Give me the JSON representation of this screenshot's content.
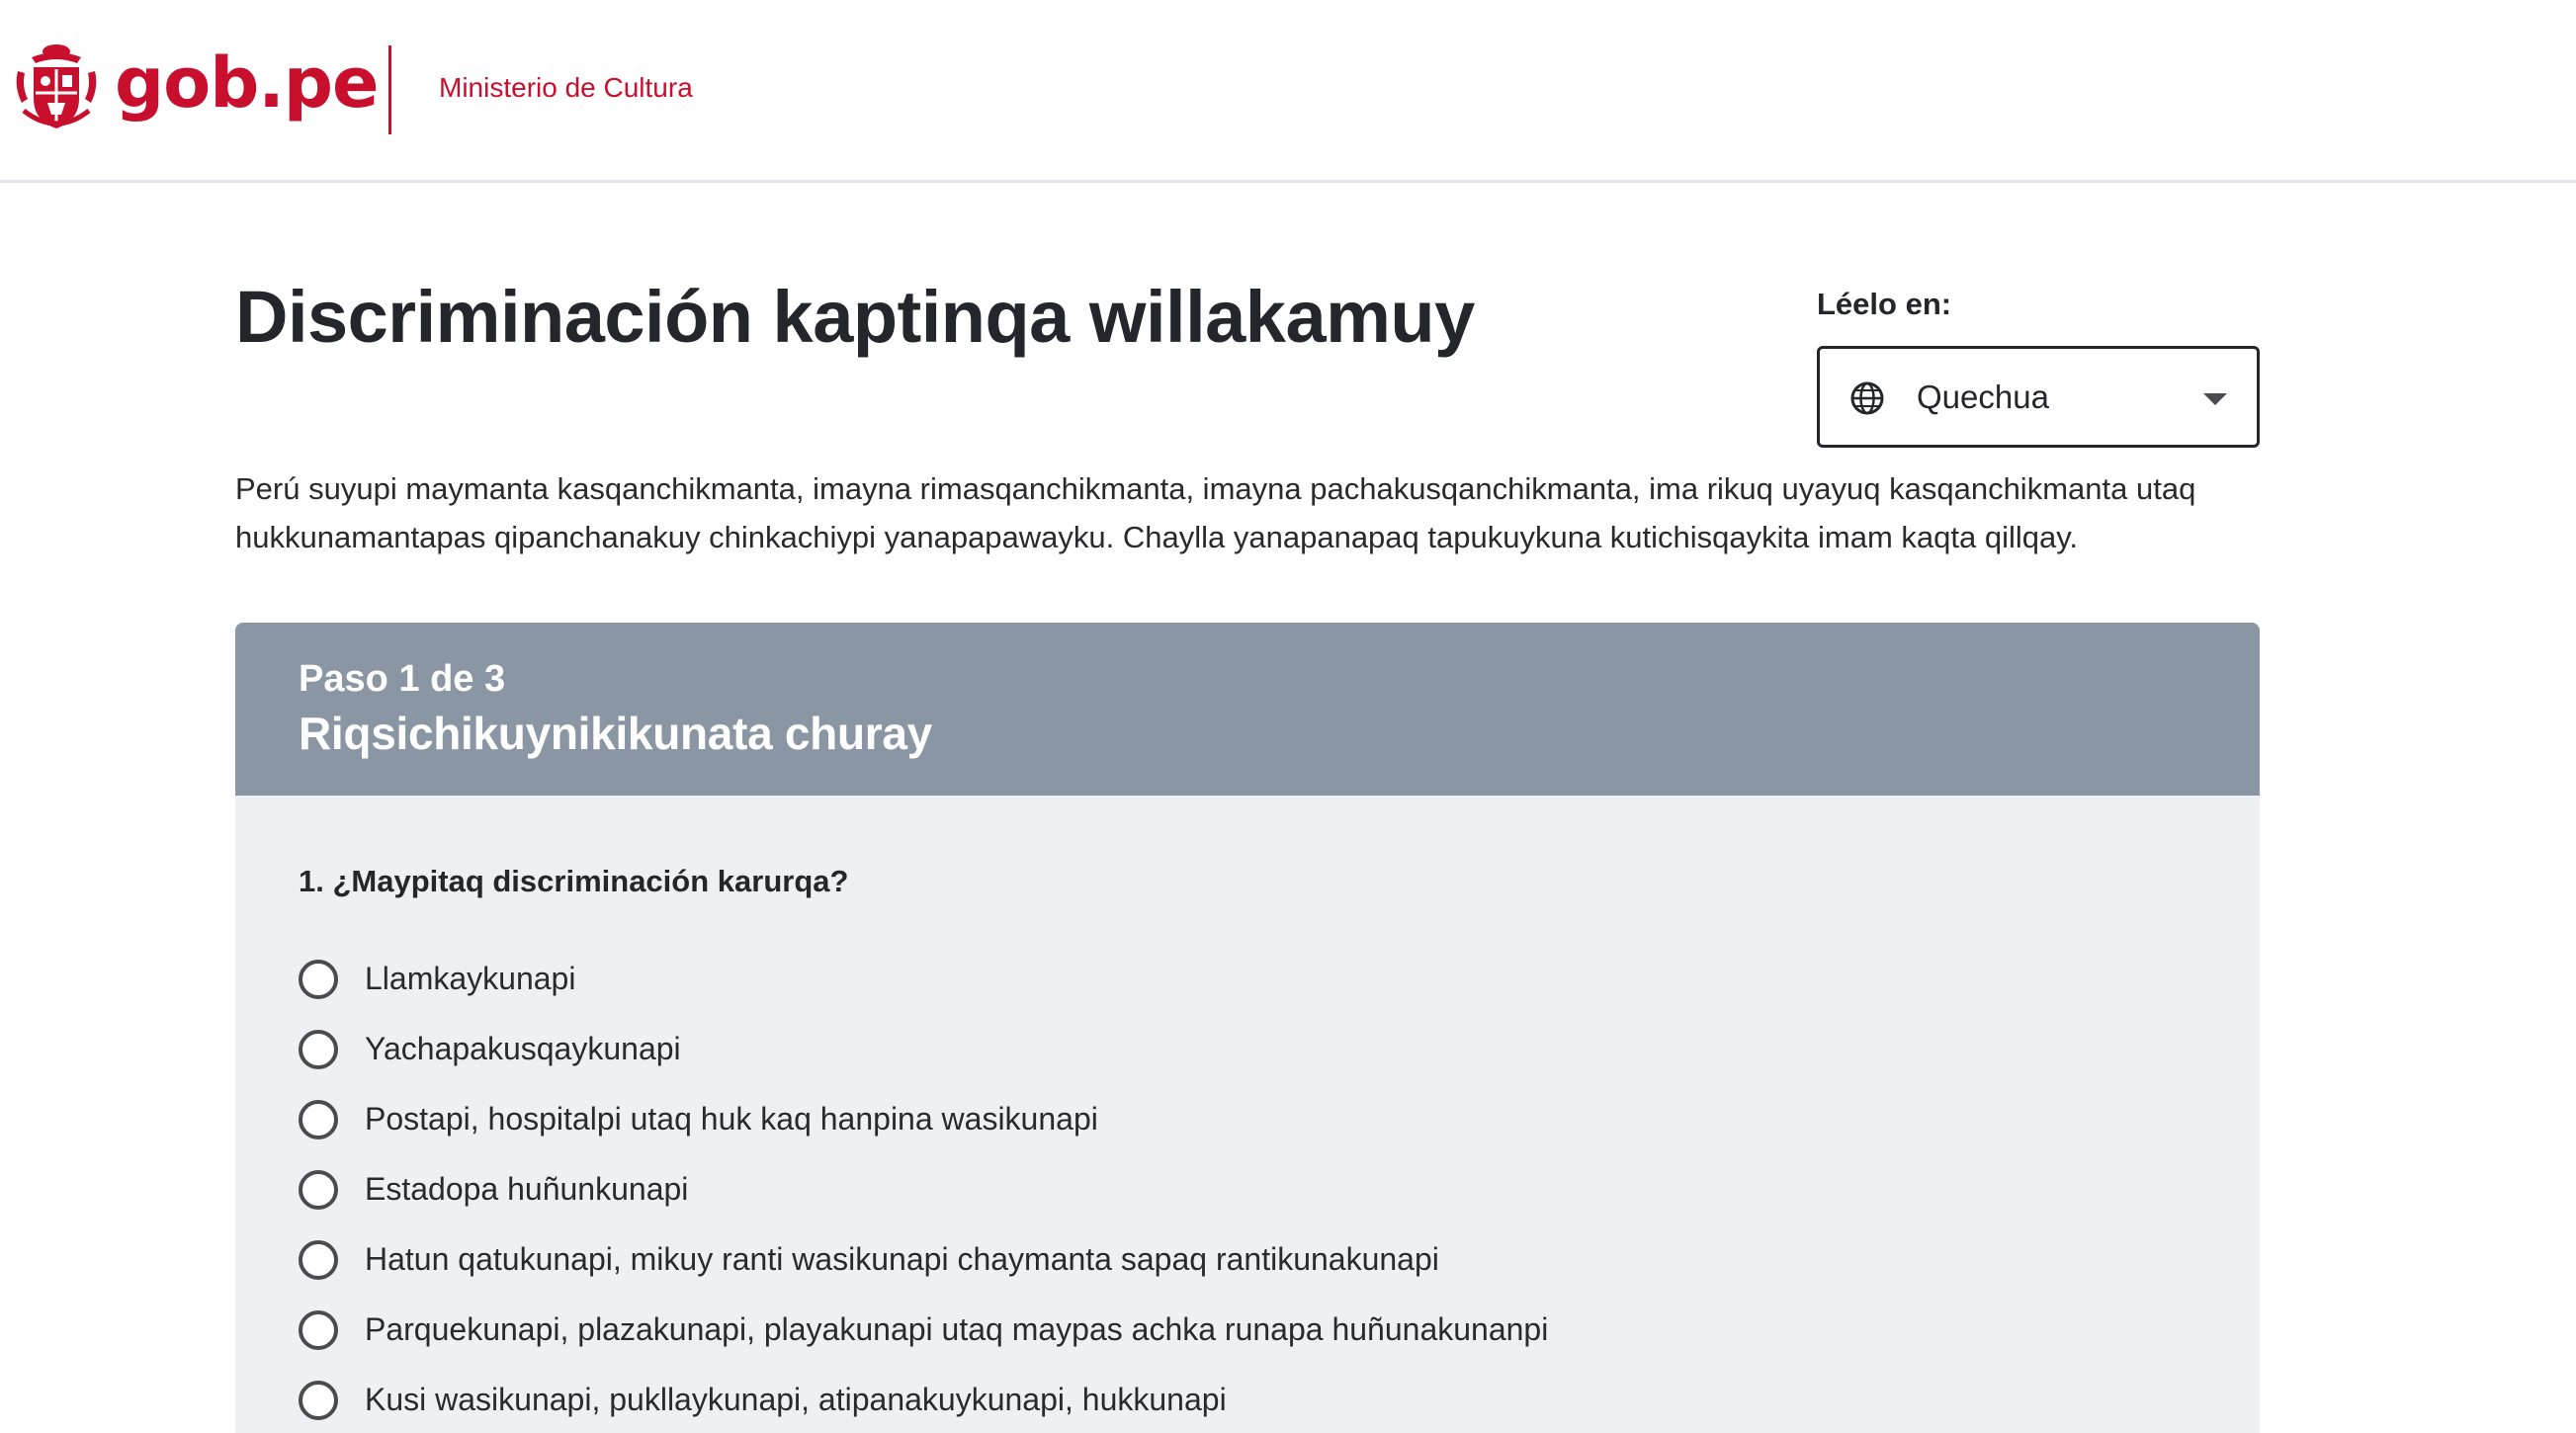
{
  "header": {
    "logo_text": "gob.pe",
    "ministry": "Ministerio de Cultura"
  },
  "page": {
    "title": "Discriminación kaptinqa willakamuy",
    "intro": "Perú suyupi maymanta kasqanchikmanta, imayna rimasqanchikmanta, imayna pachakusqanchikmanta, ima rikuq uyayuq kasqanchikmanta utaq hukkunamantapas qipanchanakuy chinkachiypi yanapapawayku. Chaylla yanapanapaq tapukuykuna kutichisqaykita imam kaqta qillqay."
  },
  "language": {
    "label": "Léelo en:",
    "selected": "Quechua",
    "icon": "globe-icon"
  },
  "step": {
    "count": "Paso 1 de 3",
    "title": "Riqsichikuynikikunata churay",
    "question": "1. ¿Maypitaq discriminación karurqa?",
    "options": [
      "Llamkaykunapi",
      "Yachapakusqaykunapi",
      "Postapi, hospitalpi utaq huk kaq hanpina wasikunapi",
      "Estadopa huñunkunapi",
      "Hatun qatukunapi, mikuy ranti wasikunapi chaymanta sapaq rantikunakunapi",
      "Parquekunapi, plazakunapi, playakunapi utaq maypas achka runapa huñunakunanpi",
      "Kusi wasikunapi, pukllaykunapi, atipanakuykunapi, hukkunapi"
    ]
  },
  "colors": {
    "brand_red": "#c8102e",
    "step_header": "#8b96a5",
    "card_bg": "#eef0f4"
  }
}
